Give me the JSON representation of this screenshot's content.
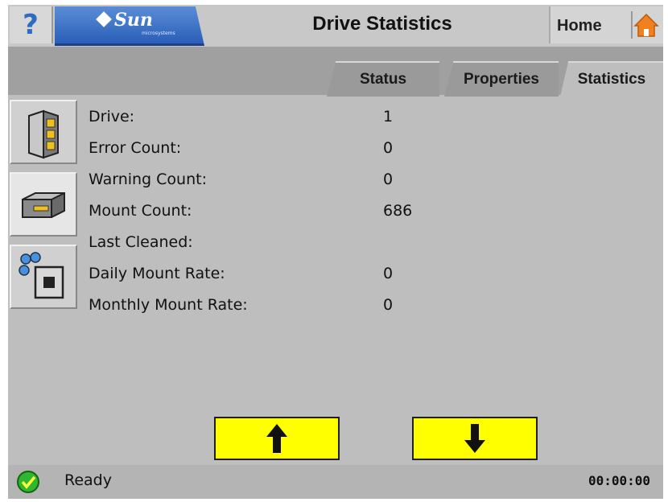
{
  "header": {
    "help_label": "?",
    "brand": "Sun",
    "brand_sub": "microsystems",
    "title": "Drive Statistics",
    "home_label": "Home"
  },
  "tabs": [
    {
      "label": "Status",
      "active": false
    },
    {
      "label": "Properties",
      "active": false
    },
    {
      "label": "Statistics",
      "active": true
    }
  ],
  "side_icons": [
    {
      "name": "library-icon"
    },
    {
      "name": "drive-icon"
    },
    {
      "name": "media-icon"
    }
  ],
  "stats": [
    {
      "label": "Drive:",
      "value": "1"
    },
    {
      "label": "Error Count:",
      "value": "0"
    },
    {
      "label": "Warning Count:",
      "value": "0"
    },
    {
      "label": "Mount Count:",
      "value": "686"
    },
    {
      "label": "Last Cleaned:",
      "value": ""
    },
    {
      "label": "Daily Mount Rate:",
      "value": "0"
    },
    {
      "label": "Monthly Mount Rate:",
      "value": "0"
    }
  ],
  "nav": {
    "up_icon": "arrow-up-icon",
    "down_icon": "arrow-down-icon"
  },
  "status": {
    "text": "Ready",
    "time": "00:00:00"
  },
  "colors": {
    "accent_blue": "#2a5fb8",
    "arrow_button": "#ffff00",
    "status_ok": "#2fb82f",
    "home_orange": "#f08020"
  }
}
